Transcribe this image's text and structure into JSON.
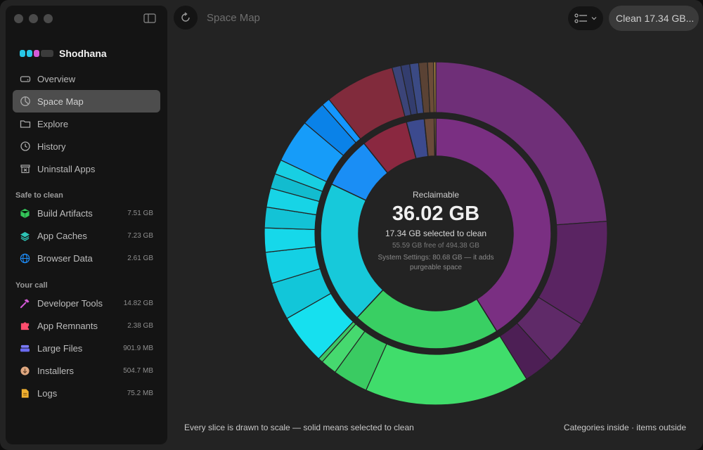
{
  "app": {
    "name": "Shodhana",
    "title": "Space Map"
  },
  "toolbar": {
    "clean_label": "Clean 17.34 GB..."
  },
  "nav": [
    {
      "label": "Overview",
      "icon": "drive-icon"
    },
    {
      "label": "Space Map",
      "icon": "pie-icon",
      "active": true
    },
    {
      "label": "Explore",
      "icon": "folder-icon"
    },
    {
      "label": "History",
      "icon": "history-icon"
    },
    {
      "label": "Uninstall Apps",
      "icon": "uninstall-icon"
    }
  ],
  "sections": {
    "safe": {
      "title": "Safe to clean",
      "items": [
        {
          "label": "Build Artifacts",
          "size": "7.51 GB",
          "icon": "cube-icon",
          "color": "#34c759"
        },
        {
          "label": "App Caches",
          "size": "7.23 GB",
          "icon": "layers-icon",
          "color": "#2ec4b6"
        },
        {
          "label": "Browser Data",
          "size": "2.61 GB",
          "icon": "globe-icon",
          "color": "#1e90ff"
        }
      ]
    },
    "yours": {
      "title": "Your call",
      "items": [
        {
          "label": "Developer Tools",
          "size": "14.82 GB",
          "icon": "hammer-icon",
          "color": "#d65ad8"
        },
        {
          "label": "App Remnants",
          "size": "2.38 GB",
          "icon": "puzzle-icon",
          "color": "#ff4d6d"
        },
        {
          "label": "Large Files",
          "size": "901.9 MB",
          "icon": "stack-icon",
          "color": "#7b7bff"
        },
        {
          "label": "Installers",
          "size": "504.7 MB",
          "icon": "download-icon",
          "color": "#e0a880"
        },
        {
          "label": "Logs",
          "size": "75.2 MB",
          "icon": "log-icon",
          "color": "#f0b030"
        }
      ]
    }
  },
  "center": {
    "label": "Reclaimable",
    "value": "36.02 GB",
    "selected": "17.34 GB selected to clean",
    "free": "55.59 GB free of 494.38 GB",
    "note": "System Settings: 80.68 GB — it adds purgeable space"
  },
  "footer": {
    "left": "Every slice is drawn to scale — solid means selected to clean",
    "right": "Categories inside · items outside"
  },
  "chart_data": {
    "type": "sunburst",
    "unit": "GB",
    "inner": [
      {
        "category": "Developer Tools",
        "value": 14.82,
        "color": "#7a2f82"
      },
      {
        "category": "Build Artifacts",
        "value": 7.51,
        "color": "#39cf63"
      },
      {
        "category": "App Caches",
        "value": 7.23,
        "color": "#17c9da"
      },
      {
        "category": "Browser Data",
        "value": 2.61,
        "color": "#1a8ef5"
      },
      {
        "category": "App Remnants",
        "value": 2.38,
        "color": "#8a2840"
      },
      {
        "category": "Large Files",
        "value": 0.9019,
        "color": "#3c4a8e"
      },
      {
        "category": "Installers",
        "value": 0.5047,
        "color": "#6a4a3a"
      },
      {
        "category": "Logs",
        "value": 0.0752,
        "color": "#e8a94c"
      }
    ],
    "outer": [
      {
        "category": "Developer Tools",
        "values": [
          8.6,
          3.6,
          1.6,
          1.02
        ],
        "colors": [
          "#6f2f78",
          "#5a2462",
          "#5f2a68",
          "#4d1f55"
        ]
      },
      {
        "category": "Build Artifacts",
        "values": [
          5.6,
          1.2,
          0.55,
          0.16
        ],
        "colors": [
          "#40dd6b",
          "#3acb62",
          "#46d96f",
          "#3dc765"
        ]
      },
      {
        "category": "App Caches",
        "values": [
          1.72,
          1.28,
          1.06,
          0.82,
          0.7,
          0.65,
          0.5,
          0.5
        ],
        "colors": [
          "#16e0ef",
          "#12c6d9",
          "#14d0e4",
          "#16d8ea",
          "#13c3d6",
          "#17d4e6",
          "#12bccf",
          "#18cfe2"
        ]
      },
      {
        "category": "Browser Data",
        "values": [
          1.48,
          0.85,
          0.28
        ],
        "colors": [
          "#169cf9",
          "#0a82e8",
          "#1496ff"
        ]
      },
      {
        "category": "App Remnants",
        "values": [
          2.38
        ],
        "colors": [
          "#812b3c"
        ]
      },
      {
        "category": "Large Files",
        "values": [
          0.3,
          0.3,
          0.3019
        ],
        "colors": [
          "#3b4478",
          "#333d6e",
          "#3b4a84"
        ]
      },
      {
        "category": "Installers",
        "values": [
          0.3,
          0.2047
        ],
        "colors": [
          "#5a4234",
          "#6b4c38"
        ]
      },
      {
        "category": "Logs",
        "values": [
          0.0752
        ],
        "colors": [
          "#a7803e"
        ]
      }
    ]
  }
}
